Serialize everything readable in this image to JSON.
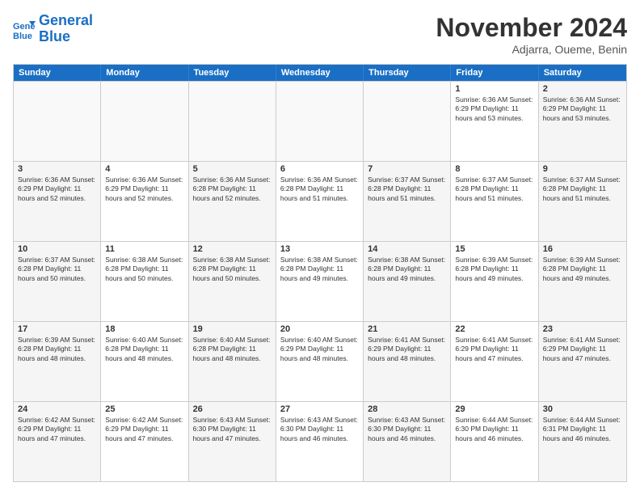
{
  "logo": {
    "line1": "General",
    "line2": "Blue"
  },
  "title": "November 2024",
  "subtitle": "Adjarra, Oueme, Benin",
  "header_days": [
    "Sunday",
    "Monday",
    "Tuesday",
    "Wednesday",
    "Thursday",
    "Friday",
    "Saturday"
  ],
  "weeks": [
    [
      {
        "day": "",
        "info": ""
      },
      {
        "day": "",
        "info": ""
      },
      {
        "day": "",
        "info": ""
      },
      {
        "day": "",
        "info": ""
      },
      {
        "day": "",
        "info": ""
      },
      {
        "day": "1",
        "info": "Sunrise: 6:36 AM\nSunset: 6:29 PM\nDaylight: 11 hours and 53 minutes."
      },
      {
        "day": "2",
        "info": "Sunrise: 6:36 AM\nSunset: 6:29 PM\nDaylight: 11 hours and 53 minutes."
      }
    ],
    [
      {
        "day": "3",
        "info": "Sunrise: 6:36 AM\nSunset: 6:29 PM\nDaylight: 11 hours and 52 minutes."
      },
      {
        "day": "4",
        "info": "Sunrise: 6:36 AM\nSunset: 6:29 PM\nDaylight: 11 hours and 52 minutes."
      },
      {
        "day": "5",
        "info": "Sunrise: 6:36 AM\nSunset: 6:28 PM\nDaylight: 11 hours and 52 minutes."
      },
      {
        "day": "6",
        "info": "Sunrise: 6:36 AM\nSunset: 6:28 PM\nDaylight: 11 hours and 51 minutes."
      },
      {
        "day": "7",
        "info": "Sunrise: 6:37 AM\nSunset: 6:28 PM\nDaylight: 11 hours and 51 minutes."
      },
      {
        "day": "8",
        "info": "Sunrise: 6:37 AM\nSunset: 6:28 PM\nDaylight: 11 hours and 51 minutes."
      },
      {
        "day": "9",
        "info": "Sunrise: 6:37 AM\nSunset: 6:28 PM\nDaylight: 11 hours and 51 minutes."
      }
    ],
    [
      {
        "day": "10",
        "info": "Sunrise: 6:37 AM\nSunset: 6:28 PM\nDaylight: 11 hours and 50 minutes."
      },
      {
        "day": "11",
        "info": "Sunrise: 6:38 AM\nSunset: 6:28 PM\nDaylight: 11 hours and 50 minutes."
      },
      {
        "day": "12",
        "info": "Sunrise: 6:38 AM\nSunset: 6:28 PM\nDaylight: 11 hours and 50 minutes."
      },
      {
        "day": "13",
        "info": "Sunrise: 6:38 AM\nSunset: 6:28 PM\nDaylight: 11 hours and 49 minutes."
      },
      {
        "day": "14",
        "info": "Sunrise: 6:38 AM\nSunset: 6:28 PM\nDaylight: 11 hours and 49 minutes."
      },
      {
        "day": "15",
        "info": "Sunrise: 6:39 AM\nSunset: 6:28 PM\nDaylight: 11 hours and 49 minutes."
      },
      {
        "day": "16",
        "info": "Sunrise: 6:39 AM\nSunset: 6:28 PM\nDaylight: 11 hours and 49 minutes."
      }
    ],
    [
      {
        "day": "17",
        "info": "Sunrise: 6:39 AM\nSunset: 6:28 PM\nDaylight: 11 hours and 48 minutes."
      },
      {
        "day": "18",
        "info": "Sunrise: 6:40 AM\nSunset: 6:28 PM\nDaylight: 11 hours and 48 minutes."
      },
      {
        "day": "19",
        "info": "Sunrise: 6:40 AM\nSunset: 6:28 PM\nDaylight: 11 hours and 48 minutes."
      },
      {
        "day": "20",
        "info": "Sunrise: 6:40 AM\nSunset: 6:29 PM\nDaylight: 11 hours and 48 minutes."
      },
      {
        "day": "21",
        "info": "Sunrise: 6:41 AM\nSunset: 6:29 PM\nDaylight: 11 hours and 48 minutes."
      },
      {
        "day": "22",
        "info": "Sunrise: 6:41 AM\nSunset: 6:29 PM\nDaylight: 11 hours and 47 minutes."
      },
      {
        "day": "23",
        "info": "Sunrise: 6:41 AM\nSunset: 6:29 PM\nDaylight: 11 hours and 47 minutes."
      }
    ],
    [
      {
        "day": "24",
        "info": "Sunrise: 6:42 AM\nSunset: 6:29 PM\nDaylight: 11 hours and 47 minutes."
      },
      {
        "day": "25",
        "info": "Sunrise: 6:42 AM\nSunset: 6:29 PM\nDaylight: 11 hours and 47 minutes."
      },
      {
        "day": "26",
        "info": "Sunrise: 6:43 AM\nSunset: 6:30 PM\nDaylight: 11 hours and 47 minutes."
      },
      {
        "day": "27",
        "info": "Sunrise: 6:43 AM\nSunset: 6:30 PM\nDaylight: 11 hours and 46 minutes."
      },
      {
        "day": "28",
        "info": "Sunrise: 6:43 AM\nSunset: 6:30 PM\nDaylight: 11 hours and 46 minutes."
      },
      {
        "day": "29",
        "info": "Sunrise: 6:44 AM\nSunset: 6:30 PM\nDaylight: 11 hours and 46 minutes."
      },
      {
        "day": "30",
        "info": "Sunrise: 6:44 AM\nSunset: 6:31 PM\nDaylight: 11 hours and 46 minutes."
      }
    ]
  ]
}
